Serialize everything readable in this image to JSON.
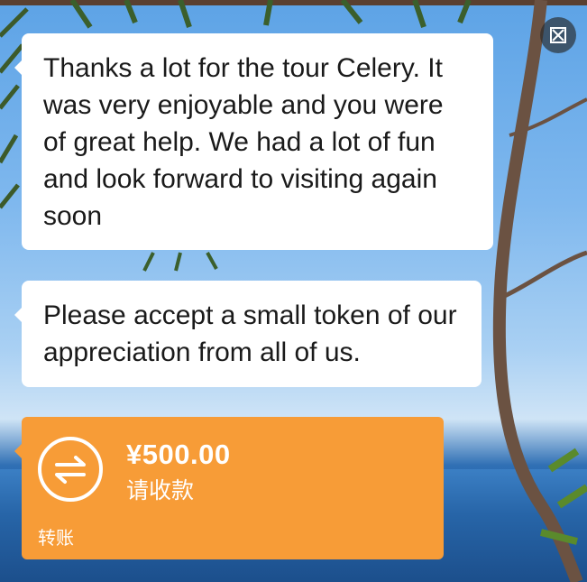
{
  "messages": [
    {
      "text": "Thanks a lot for the tour Celery. It was very enjoyable and you were of great help. We had a lot of fun and look forward to visiting again soon"
    },
    {
      "text": "Please accept a small token of our appreciation from all of us."
    }
  ],
  "transfer": {
    "amount": "¥500.00",
    "status": "请收款",
    "label": "转账",
    "icon": "transfer-arrows-icon",
    "color": "#f79c37"
  },
  "controls": {
    "expand_icon": "expand-icon"
  }
}
